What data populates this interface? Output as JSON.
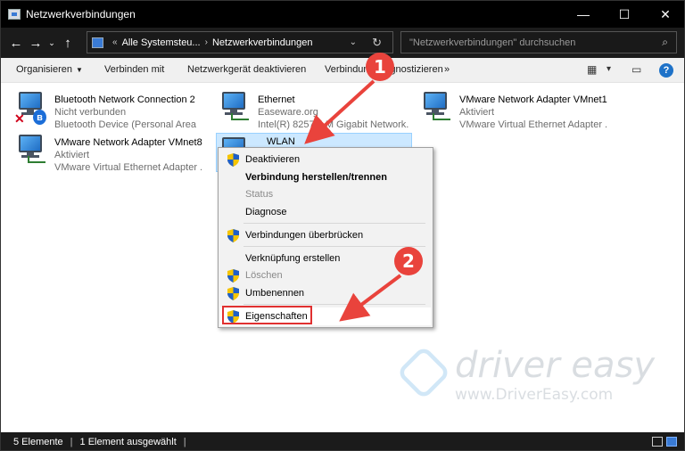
{
  "window": {
    "title": "Netzwerkverbindungen",
    "controls": {
      "minimize": "—",
      "maximize": "☐",
      "close": "✕"
    }
  },
  "nav": {
    "back": "←",
    "forward": "→",
    "recent": "⌄",
    "up": "↑",
    "breadcrumb_chevron": "«",
    "path_1": "Alle Systemsteu...",
    "path_sep": "›",
    "path_2": "Netzwerkverbindungen",
    "dropdown": "⌄",
    "refresh": "↻"
  },
  "search": {
    "placeholder": "\"Netzwerkverbindungen\" durchsuchen",
    "icon": "search-icon"
  },
  "toolbar": {
    "organize": "Organisieren",
    "connect_to": "Verbinden mit",
    "disable_device": "Netzwerkgerät deaktivieren",
    "diagnose": "Verbindung diagnostizieren",
    "more": "»",
    "change_view": "▦",
    "view_caret": "▾",
    "preview_pane": "▭",
    "help": "?"
  },
  "connections": [
    {
      "name": "Bluetooth Network Connection 2",
      "status": "Nicht verbunden",
      "device": "Bluetooth Device (Personal Area ..."
    },
    {
      "name": "Ethernet",
      "status": "Easeware.org",
      "device": "Intel(R) 82579LM Gigabit Network..."
    },
    {
      "name": "VMware Network Adapter VMnet1",
      "status": "Aktiviert",
      "device": "VMware Virtual Ethernet Adapter ..."
    },
    {
      "name": "VMware Network Adapter VMnet8",
      "status": "Aktiviert",
      "device": "VMware Virtual Ethernet Adapter ..."
    },
    {
      "name": "WLAN"
    }
  ],
  "context_menu": {
    "deactivate": "Deaktivieren",
    "connect_disconnect": "Verbindung herstellen/trennen",
    "status": "Status",
    "diagnose": "Diagnose",
    "bridge": "Verbindungen überbrücken",
    "create_shortcut": "Verknüpfung erstellen",
    "delete": "Löschen",
    "rename": "Umbenennen",
    "properties": "Eigenschaften"
  },
  "annotations": {
    "step1": "1",
    "step2": "2",
    "color": "#e9433c"
  },
  "watermark": {
    "brand": "driver easy",
    "url": "www.DriverEasy.com"
  },
  "statusbar": {
    "count": "5 Elemente",
    "selected": "1 Element ausgewählt",
    "sep": "|"
  }
}
